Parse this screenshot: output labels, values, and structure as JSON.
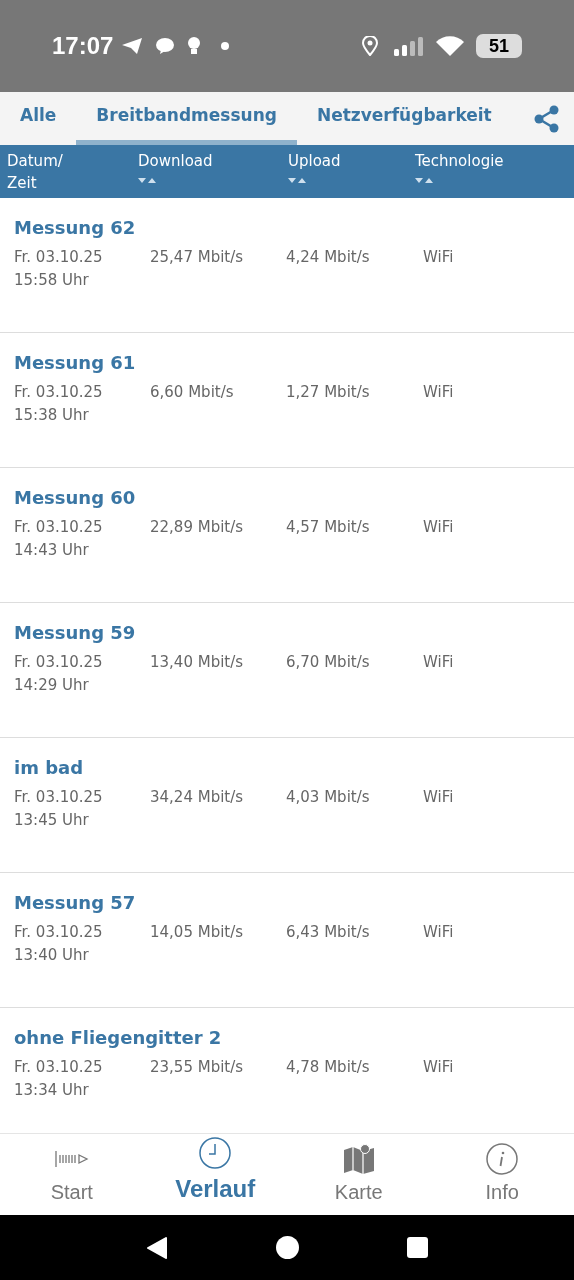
{
  "status_bar": {
    "time": "17:07",
    "battery": "51"
  },
  "tabs": [
    {
      "label": "Alle",
      "selected": false
    },
    {
      "label": "Breitbandmessung",
      "selected": true
    },
    {
      "label": "Netzverfügbarkeit",
      "selected": false
    }
  ],
  "table": {
    "columns": [
      {
        "label": "Datum/ Zeit",
        "kind": "plain"
      },
      {
        "label": "Download",
        "kind": "sortable"
      },
      {
        "label": "Upload",
        "kind": "sortable"
      },
      {
        "label": "Technologie",
        "kind": "sortable"
      }
    ],
    "rows": [
      {
        "title": "Messung 62",
        "date": "Fr. 03.10.25",
        "time": "15:58 Uhr",
        "download": "25,47 Mbit/s",
        "upload": "4,24 Mbit/s",
        "technology": "WiFi"
      },
      {
        "title": "Messung 61",
        "date": "Fr. 03.10.25",
        "time": "15:38 Uhr",
        "download": "6,60 Mbit/s",
        "upload": "1,27 Mbit/s",
        "technology": "WiFi"
      },
      {
        "title": "Messung 60",
        "date": "Fr. 03.10.25",
        "time": "14:43 Uhr",
        "download": "22,89 Mbit/s",
        "upload": "4,57 Mbit/s",
        "technology": "WiFi"
      },
      {
        "title": "Messung 59",
        "date": "Fr. 03.10.25",
        "time": "14:29 Uhr",
        "download": "13,40 Mbit/s",
        "upload": "6,70 Mbit/s",
        "technology": "WiFi"
      },
      {
        "title": "im bad",
        "date": "Fr. 03.10.25",
        "time": "13:45 Uhr",
        "download": "34,24 Mbit/s",
        "upload": "4,03 Mbit/s",
        "technology": "WiFi"
      },
      {
        "title": "Messung 57",
        "date": "Fr. 03.10.25",
        "time": "13:40 Uhr",
        "download": "14,05 Mbit/s",
        "upload": "6,43 Mbit/s",
        "technology": "WiFi"
      },
      {
        "title": "ohne Fliegengitter 2",
        "date": "Fr. 03.10.25",
        "time": "13:34 Uhr",
        "download": "23,55 Mbit/s",
        "upload": "4,78 Mbit/s",
        "technology": "WiFi"
      }
    ]
  },
  "bottom_nav": [
    {
      "label": "Start",
      "kind": "start",
      "selected": false
    },
    {
      "label": "Verlauf",
      "kind": "history",
      "selected": true
    },
    {
      "label": "Karte",
      "kind": "map",
      "selected": false
    },
    {
      "label": "Info",
      "kind": "info",
      "selected": false
    }
  ]
}
